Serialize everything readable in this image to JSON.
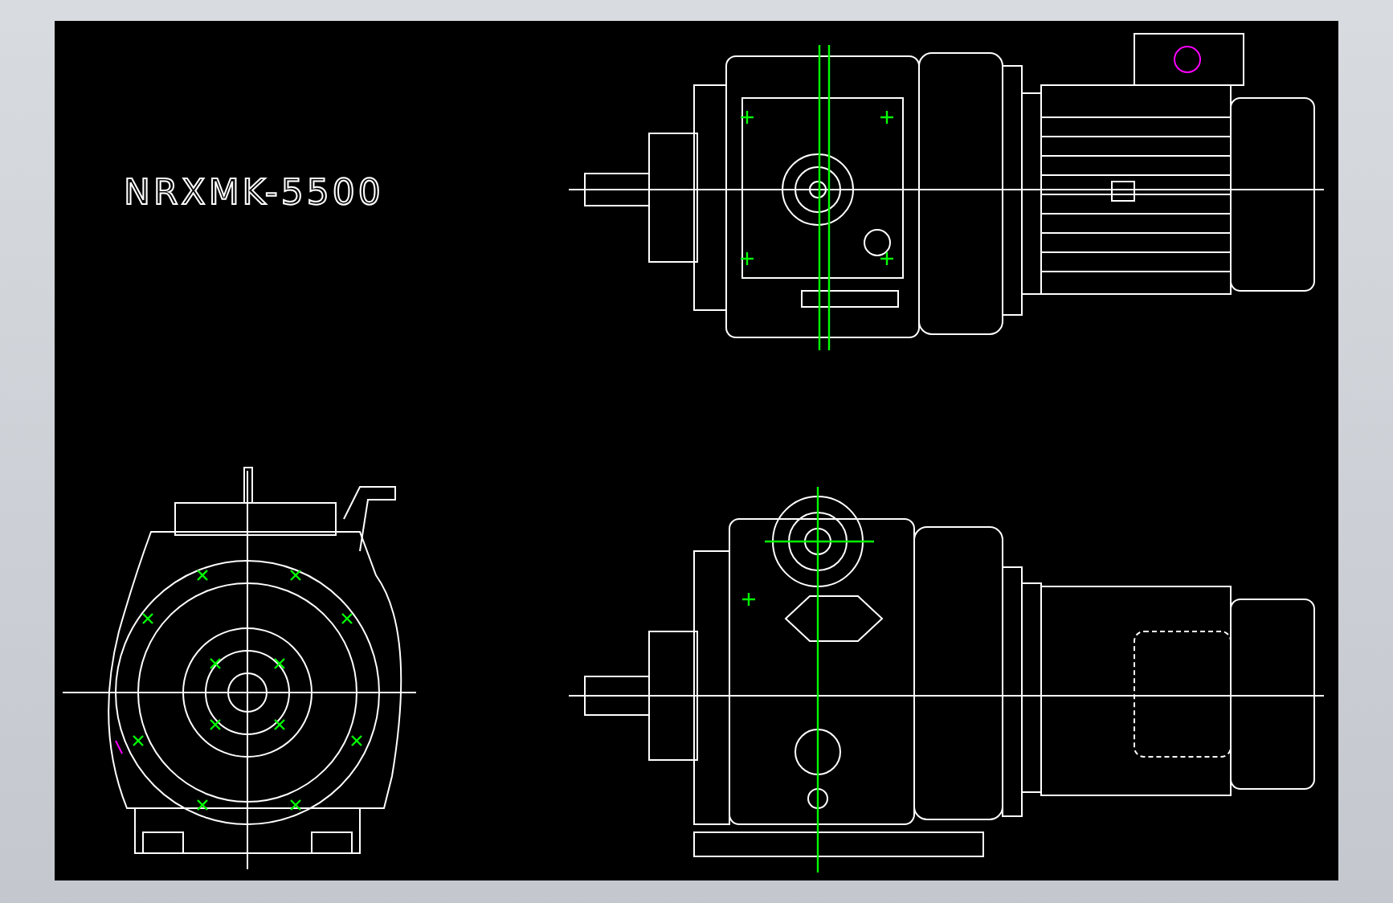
{
  "drawing": {
    "title": "NRXMK-5500"
  }
}
